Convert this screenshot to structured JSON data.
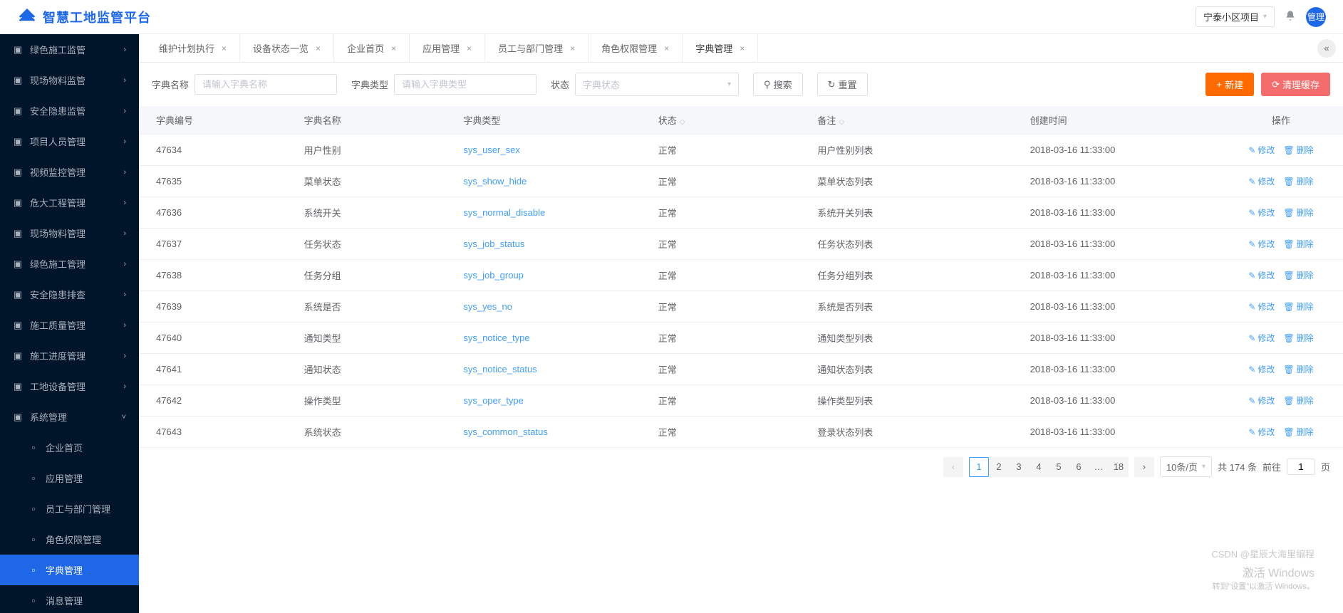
{
  "header": {
    "logo_text": "智慧工地监管平台",
    "project_label": "宁泰小区项目",
    "avatar_label": "管理"
  },
  "sidebar": {
    "items": [
      {
        "label": "绿色施工监管",
        "icon": "leaf-icon",
        "expandable": true
      },
      {
        "label": "现场物料监管",
        "icon": "cube-icon",
        "expandable": true
      },
      {
        "label": "安全隐患监管",
        "icon": "shield-icon",
        "expandable": true
      },
      {
        "label": "项目人员管理",
        "icon": "users-icon",
        "expandable": true
      },
      {
        "label": "视频监控管理",
        "icon": "camera-icon",
        "expandable": true
      },
      {
        "label": "危大工程管理",
        "icon": "warning-icon",
        "expandable": true
      },
      {
        "label": "现场物料管理",
        "icon": "box-icon",
        "expandable": true
      },
      {
        "label": "绿色施工管理",
        "icon": "leaf2-icon",
        "expandable": true
      },
      {
        "label": "安全隐患排查",
        "icon": "list-icon",
        "expandable": true
      },
      {
        "label": "施工质量管理",
        "icon": "quality-icon",
        "expandable": true
      },
      {
        "label": "施工进度管理",
        "icon": "progress-icon",
        "expandable": true
      },
      {
        "label": "工地设备管理",
        "icon": "device-icon",
        "expandable": true
      },
      {
        "label": "系统管理",
        "icon": "gear-icon",
        "expandable": true,
        "expanded": true
      }
    ],
    "sub_items": [
      {
        "label": "企业首页",
        "icon": "home-icon"
      },
      {
        "label": "应用管理",
        "icon": "apps-icon"
      },
      {
        "label": "员工与部门管理",
        "icon": "user-icon"
      },
      {
        "label": "角色权限管理",
        "icon": "role-icon"
      },
      {
        "label": "字典管理",
        "icon": "dict-icon",
        "active": true
      },
      {
        "label": "消息管理",
        "icon": "msg-icon"
      }
    ]
  },
  "tabs": [
    {
      "label": "维护计划执行",
      "closable": true
    },
    {
      "label": "设备状态一览",
      "closable": true
    },
    {
      "label": "企业首页",
      "closable": true
    },
    {
      "label": "应用管理",
      "closable": true
    },
    {
      "label": "员工与部门管理",
      "closable": true
    },
    {
      "label": "角色权限管理",
      "closable": true
    },
    {
      "label": "字典管理",
      "closable": true,
      "active": true
    }
  ],
  "filters": {
    "name_label": "字典名称",
    "name_placeholder": "请输入字典名称",
    "type_label": "字典类型",
    "type_placeholder": "请输入字典类型",
    "status_label": "状态",
    "status_placeholder": "字典状态",
    "search_btn": "搜索",
    "reset_btn": "重置",
    "new_btn": "新建",
    "cache_btn": "清理缓存"
  },
  "table": {
    "columns": [
      "字典编号",
      "字典名称",
      "字典类型",
      "状态",
      "备注",
      "创建时间",
      "操作"
    ],
    "op_edit": "修改",
    "op_delete": "删除",
    "rows": [
      {
        "id": "47634",
        "name": "用户性别",
        "type": "sys_user_sex",
        "status": "正常",
        "remark": "用户性别列表",
        "created": "2018-03-16 11:33:00"
      },
      {
        "id": "47635",
        "name": "菜单状态",
        "type": "sys_show_hide",
        "status": "正常",
        "remark": "菜单状态列表",
        "created": "2018-03-16 11:33:00"
      },
      {
        "id": "47636",
        "name": "系统开关",
        "type": "sys_normal_disable",
        "status": "正常",
        "remark": "系统开关列表",
        "created": "2018-03-16 11:33:00"
      },
      {
        "id": "47637",
        "name": "任务状态",
        "type": "sys_job_status",
        "status": "正常",
        "remark": "任务状态列表",
        "created": "2018-03-16 11:33:00"
      },
      {
        "id": "47638",
        "name": "任务分组",
        "type": "sys_job_group",
        "status": "正常",
        "remark": "任务分组列表",
        "created": "2018-03-16 11:33:00"
      },
      {
        "id": "47639",
        "name": "系统是否",
        "type": "sys_yes_no",
        "status": "正常",
        "remark": "系统是否列表",
        "created": "2018-03-16 11:33:00"
      },
      {
        "id": "47640",
        "name": "通知类型",
        "type": "sys_notice_type",
        "status": "正常",
        "remark": "通知类型列表",
        "created": "2018-03-16 11:33:00"
      },
      {
        "id": "47641",
        "name": "通知状态",
        "type": "sys_notice_status",
        "status": "正常",
        "remark": "通知状态列表",
        "created": "2018-03-16 11:33:00"
      },
      {
        "id": "47642",
        "name": "操作类型",
        "type": "sys_oper_type",
        "status": "正常",
        "remark": "操作类型列表",
        "created": "2018-03-16 11:33:00"
      },
      {
        "id": "47643",
        "name": "系统状态",
        "type": "sys_common_status",
        "status": "正常",
        "remark": "登录状态列表",
        "created": "2018-03-16 11:33:00"
      }
    ]
  },
  "pagination": {
    "pages": [
      "1",
      "2",
      "3",
      "4",
      "5",
      "6",
      "…",
      "18"
    ],
    "current": "1",
    "size_label": "10条/页",
    "total_label": "共 174 条",
    "goto_label": "前往",
    "goto_value": "1",
    "goto_suffix": "页"
  },
  "watermark": {
    "line1": "CSDN @星辰大海里编程",
    "line2": "激活 Windows",
    "line3": "转到\"设置\"以激活 Windows。"
  }
}
